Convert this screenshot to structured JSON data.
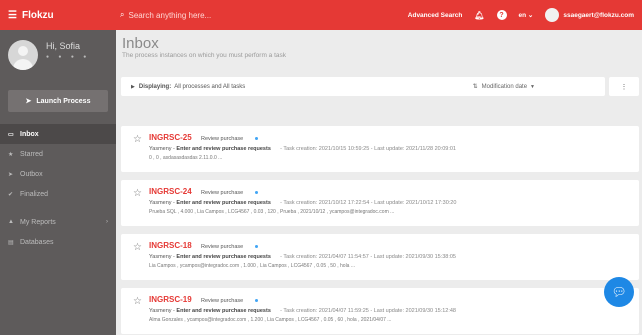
{
  "header": {
    "app_name": "Flokzu",
    "search_placeholder": "Search anything here...",
    "advanced_search": "Advanced Search",
    "language": "en",
    "user_email": "ssaegaert@flokzu.com"
  },
  "sidebar": {
    "user_name": "Hi, Sofia",
    "launch_label": "Launch Process",
    "items": [
      {
        "label": "Inbox",
        "icon": "inbox-icon",
        "active": true
      },
      {
        "label": "Starred",
        "icon": "star-icon"
      },
      {
        "label": "Outbox",
        "icon": "send-icon"
      },
      {
        "label": "Finalized",
        "icon": "check-icon"
      },
      {
        "label": "My Reports",
        "icon": "chart-icon"
      },
      {
        "label": "Databases",
        "icon": "database-icon"
      }
    ]
  },
  "main": {
    "title": "Inbox",
    "subtitle": "The process instances on which you must perform a task",
    "filter_prefix": "Displaying:",
    "filter_value": "All processes and All tasks",
    "sort_label": "Modification date",
    "more_label": "⋮"
  },
  "cards": [
    {
      "code": "INGRSC-25",
      "tag": "Review purchase",
      "assignee": "Yasmeny",
      "task": "Enter and review purchase requests",
      "meta": "- Task creation: 2021/10/15 10:59:25 - Last update: 2021/11/28 20:09:01",
      "details": "0 , 0 , asdasasdasdas 2.11.0.0 ..."
    },
    {
      "code": "INGRSC-24",
      "tag": "Review purchase",
      "assignee": "Yasmeny",
      "task": "Enter and review purchase requests",
      "meta": "- Task creation: 2021/10/12 17:22:54 - Last update: 2021/10/12 17:30:20",
      "details": "Prueba SQL , 4.000 , Lia Campos , LCG4567 , 0.03 , 120 , Prueba , 2021/10/12 , ycampos@integradoc.com ..."
    },
    {
      "code": "INGRSC-18",
      "tag": "Review purchase",
      "assignee": "Yasmeny",
      "task": "Enter and review purchase requests",
      "meta": "- Task creation: 2021/04/07 11:54:57 - Last update: 2021/09/30 15:38:05",
      "details": "Lia Campos , ycampos@integradoc.com , 1.000 , Lia Campos , LCG4567 , 0.05 , 50 , hola ..."
    },
    {
      "code": "INGRSC-19",
      "tag": "Review purchase",
      "assignee": "Yasmeny",
      "task": "Enter and review purchase requests",
      "meta": "- Task creation: 2021/04/07 11:59:25 - Last update: 2021/09/30 15:12:48",
      "details": "Alma Gonzales , ycampos@integradoc.com , 1.200 , Lia Campos , LCG4567 , 0.05 , 60 , hola , 2021/04/07 ..."
    }
  ]
}
